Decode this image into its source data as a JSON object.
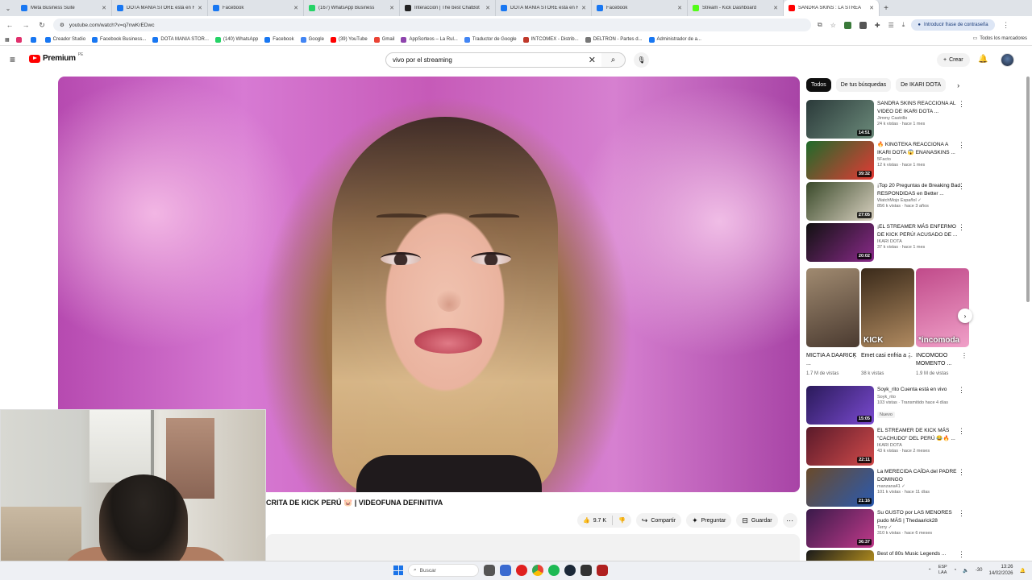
{
  "browser": {
    "tabs": [
      {
        "title": "Meta Business Suite",
        "color": "#1877f2",
        "active": false
      },
      {
        "title": "DOTA MANIA STORE está en Fa",
        "color": "#1877f2",
        "active": false
      },
      {
        "title": "Facebook",
        "color": "#1877f2",
        "active": false
      },
      {
        "title": "(167) WhatsApp Business",
        "color": "#25d366",
        "active": false
      },
      {
        "title": "Interacción | The best ChatBot",
        "color": "#222222",
        "active": false
      },
      {
        "title": "DOTA MANIA STORE está en Fa",
        "color": "#1877f2",
        "active": false
      },
      {
        "title": "Facebook",
        "color": "#1877f2",
        "active": false
      },
      {
        "title": "Stream - Kick Dashboard",
        "color": "#53fc18",
        "active": false
      },
      {
        "title": "SANDRA SKINS : LA STREA",
        "color": "#ff0000",
        "active": true
      }
    ],
    "url": "youtube.com/watch?v=q7nwKrEDwc",
    "profile_label": "Introducir frase de contraseña",
    "bookmarks": [
      {
        "label": "",
        "color": "#e1306c"
      },
      {
        "label": "",
        "color": "#1877f2"
      },
      {
        "label": "Creador Studio",
        "color": "#1877f2"
      },
      {
        "label": "Facebook Business...",
        "color": "#1877f2"
      },
      {
        "label": "DOTA MANIA STOR...",
        "color": "#1877f2"
      },
      {
        "label": "(140) WhatsApp",
        "color": "#25d366"
      },
      {
        "label": "Facebook",
        "color": "#1877f2"
      },
      {
        "label": "Google",
        "color": "#4285f4"
      },
      {
        "label": "(39) YouTube",
        "color": "#ff0000"
      },
      {
        "label": "Gmail",
        "color": "#ea4335"
      },
      {
        "label": "AppSorteos – La Rul...",
        "color": "#8e44ad"
      },
      {
        "label": "Traductor de Google",
        "color": "#4285f4"
      },
      {
        "label": "INTCOMEX - Distrib...",
        "color": "#c0392b"
      },
      {
        "label": "DELTRON - Partes d...",
        "color": "#777777"
      },
      {
        "label": "Administrador de a...",
        "color": "#1877f2"
      }
    ],
    "bookmarks_all": "Todos los marcadores"
  },
  "youtube": {
    "logo": "Premium",
    "logo_country": "PE",
    "search_value": "vivo por el streaming",
    "create_label": "Crear",
    "video_title": "CRITA DE KICK PERÚ 🐷 | VIDEOFUNA DEFINITIVA",
    "likes": "9.7 K",
    "share": "Compartir",
    "ask": "Preguntar",
    "save": "Guardar",
    "chips": [
      "Todos",
      "De tus búsquedas",
      "De IKARI DOTA"
    ],
    "recs_top": [
      {
        "title": "SANDRA SKINS REACCIONA AL VIDEO DE IKARI DOTA ...",
        "channel": "Jimmy Castrillo",
        "stats": "24 k vistas · hace 1 mes",
        "duration": "14:51",
        "c1": "#2b3a3a",
        "c2": "#6b8a7a"
      },
      {
        "title": "🔥 KINGTEKA REACCIONA A IKARI DOTA 😱 ENANASKINS ...",
        "channel": "5Facto",
        "stats": "12 k vistas · hace 1 mes",
        "duration": "39:32",
        "c1": "#1e6b2a",
        "c2": "#e53935"
      },
      {
        "title": "¡Top 20 Preguntas de Breaking Bad RESPONDIDAS en Better ...",
        "channel": "WatchMojo Español ✓",
        "stats": "856 k vistas · hace 3 años",
        "duration": "27:05",
        "c1": "#3a4a2a",
        "c2": "#d8d0c0"
      },
      {
        "title": "¡EL STREAMER MÁS ENFERMO DE KICK PERÚ! ACUSADO DE ...",
        "channel": "IKARI DOTA",
        "stats": "37 k vistas · hace 1 mes",
        "duration": "20:02",
        "c1": "#111111",
        "c2": "#8a2a8a"
      }
    ],
    "shorts": [
      {
        "title": "MICTIA A DAARICK ...",
        "views": "1.7 M de vistas",
        "overlay": "",
        "c1": "#a08a70",
        "c2": "#4a3a30"
      },
      {
        "title": "Emet casi enfria a ...",
        "views": "38 k vistas",
        "overlay": "KICK",
        "c1": "#3a2a1a",
        "c2": "#b08a60"
      },
      {
        "title": "INCOMODO MOMENTO ...",
        "views": "1.9 M de vistas",
        "overlay": "*incomoda",
        "c1": "#c04a8a",
        "c2": "#f0a0c8"
      }
    ],
    "recs_bottom": [
      {
        "title": "Soyk_rito Cuenta está en vivo",
        "channel": "Soyk_rito",
        "stats": "103 vistas · Transmitido hace 4 días",
        "badge": "Nuevo",
        "duration": "15:05",
        "c1": "#2a1a5a",
        "c2": "#7a4ad0"
      },
      {
        "title": "EL STREAMER DE KICK MÁS \"CACHUDO\" DEL PERÚ 😂🔥 ...",
        "channel": "IKARI DOTA",
        "stats": "43 k vistas · hace 2 meses",
        "badge": "",
        "duration": "22:11",
        "c1": "#5a1a2a",
        "c2": "#d04a4a"
      },
      {
        "title": "La MERECIDA CAÍDA del PADRE DOMINGO",
        "channel": "manzana41 ✓",
        "stats": "101 k vistas · hace 11 días",
        "badge": "",
        "duration": "21:16",
        "c1": "#6a4a2a",
        "c2": "#2a5ab0"
      },
      {
        "title": "Su GUSTO por LAS MENORES pudo MÁS | Thedaarick28",
        "channel": "Terry ✓",
        "stats": "310 k vistas · hace 6 meses",
        "badge": "",
        "duration": "36:37",
        "c1": "#3a1a4a",
        "c2": "#c03a8a"
      },
      {
        "title": "Best of 80s Music Legends ...",
        "channel": "",
        "stats": "",
        "badge": "",
        "duration": "",
        "c1": "#1a1a1a",
        "c2": "#e0b020"
      }
    ]
  },
  "taskbar": {
    "search": "Buscar",
    "lang_top": "ESP",
    "lang_bottom": "LAA",
    "volume": "-30",
    "time": "13:26",
    "date": "14/02/2026"
  }
}
